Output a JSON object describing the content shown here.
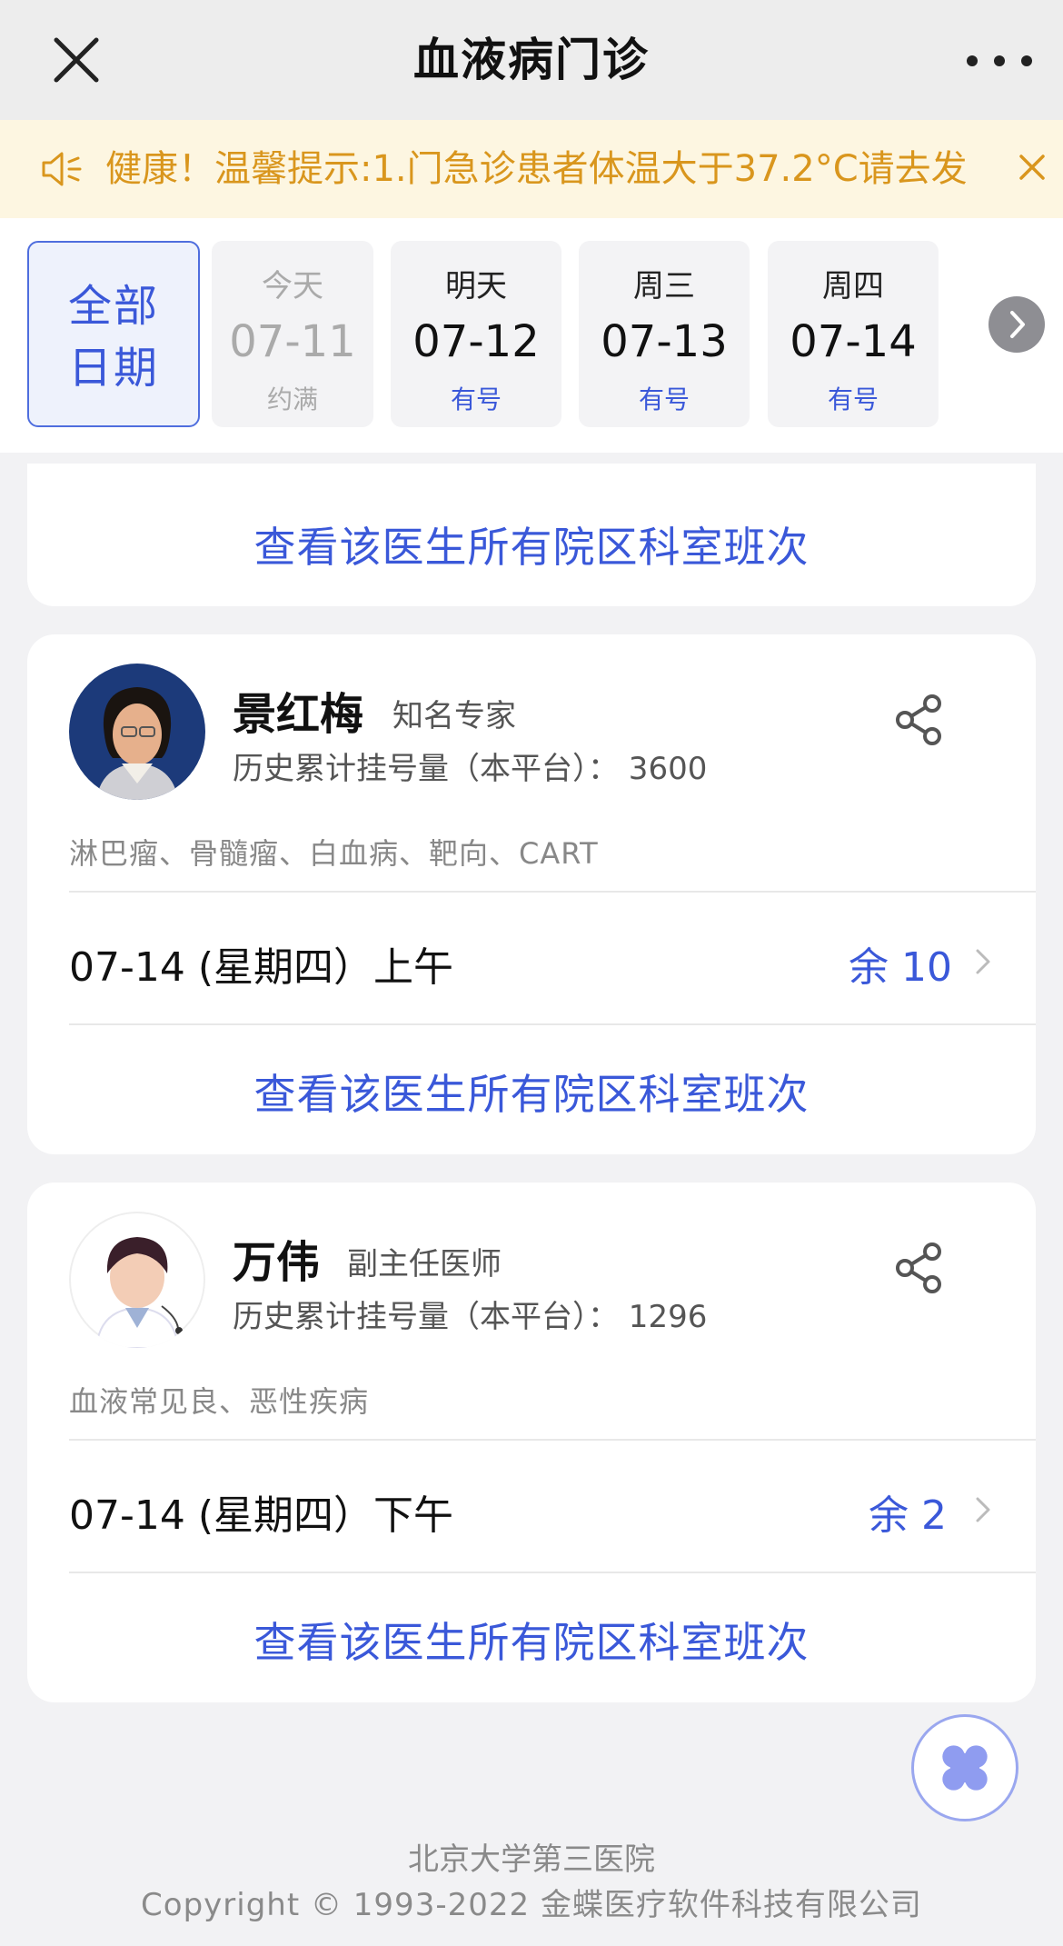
{
  "header": {
    "title": "血液病门诊",
    "close_icon": "close-icon",
    "more_icon": "more-icon"
  },
  "notice": {
    "text": "健康！温馨提示:1.门急诊患者体温大于37.2°C请去发",
    "icon": "speaker-icon",
    "close_icon": "close-icon"
  },
  "dates": {
    "all_label_line1": "全部",
    "all_label_line2": "日期",
    "items": [
      {
        "name": "今天",
        "date": "07-11",
        "status": "约满"
      },
      {
        "name": "明天",
        "date": "07-12",
        "status": "有号"
      },
      {
        "name": "周三",
        "date": "07-13",
        "status": "有号"
      },
      {
        "name": "周四",
        "date": "07-14",
        "status": "有号"
      }
    ]
  },
  "link_text": "查看该医生所有院区科室班次",
  "doctors": [
    {
      "name": "景红梅",
      "title": "知名专家",
      "count": "历史累计挂号量（本平台）： 3600",
      "specialty": "淋巴瘤、骨髓瘤、白血病、靶向、CART",
      "slot": "07-14 (星期四）上午",
      "remain": "余 10"
    },
    {
      "name": "万伟",
      "title": "副主任医师",
      "count": "历史累计挂号量（本平台）： 1296",
      "specialty": "血液常见良、恶性疾病",
      "slot": "07-14 (星期四）下午",
      "remain": "余 2"
    }
  ],
  "footer": {
    "hospital": "北京大学第三医院",
    "copyright": "Copyright © 1993-2022 金蝶医疗软件科技有限公司"
  },
  "colors": {
    "accent": "#3a58d9",
    "notice_text": "#d9961d",
    "notice_bg": "#fdf6e1"
  }
}
